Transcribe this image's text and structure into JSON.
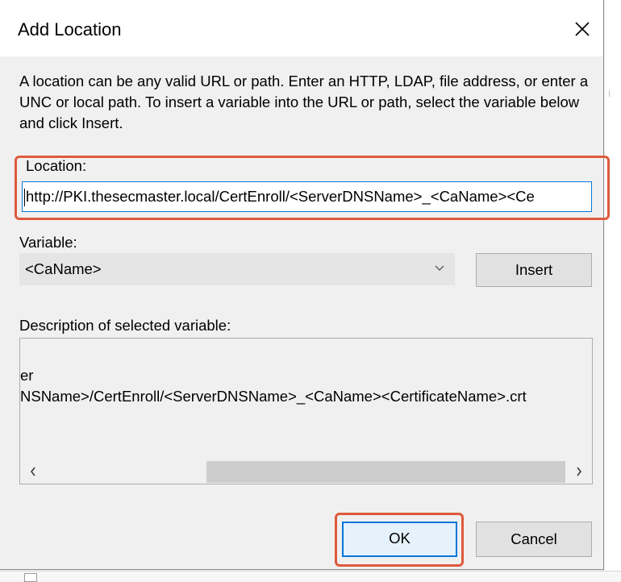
{
  "dialog": {
    "title": "Add Location",
    "intro": "A location can be any valid URL or path. Enter an HTTP, LDAP, file address, or enter a UNC or local path. To insert a variable into the URL or path, select the variable below and click Insert."
  },
  "location": {
    "label": "Location:",
    "value": "http://PKI.thesecmaster.local/CertEnroll/<ServerDNSName>_<CaName><Ce"
  },
  "variable": {
    "label": "Variable:",
    "selected": "<CaName>",
    "insert_label": "Insert"
  },
  "description": {
    "label": "Description of selected variable:",
    "lines": [
      "er",
      "NSName>/CertEnroll/<ServerDNSName>_<CaName><CertificateName>.crt"
    ]
  },
  "buttons": {
    "ok": "OK",
    "cancel": "Cancel"
  },
  "icons": {
    "close": "close-icon",
    "dropdown": "chevron-down-icon",
    "scroll_left": "chevron-left-icon",
    "scroll_right": "chevron-right-icon"
  },
  "colors": {
    "accent": "#0078d7",
    "highlight": "#dd5a3c"
  }
}
